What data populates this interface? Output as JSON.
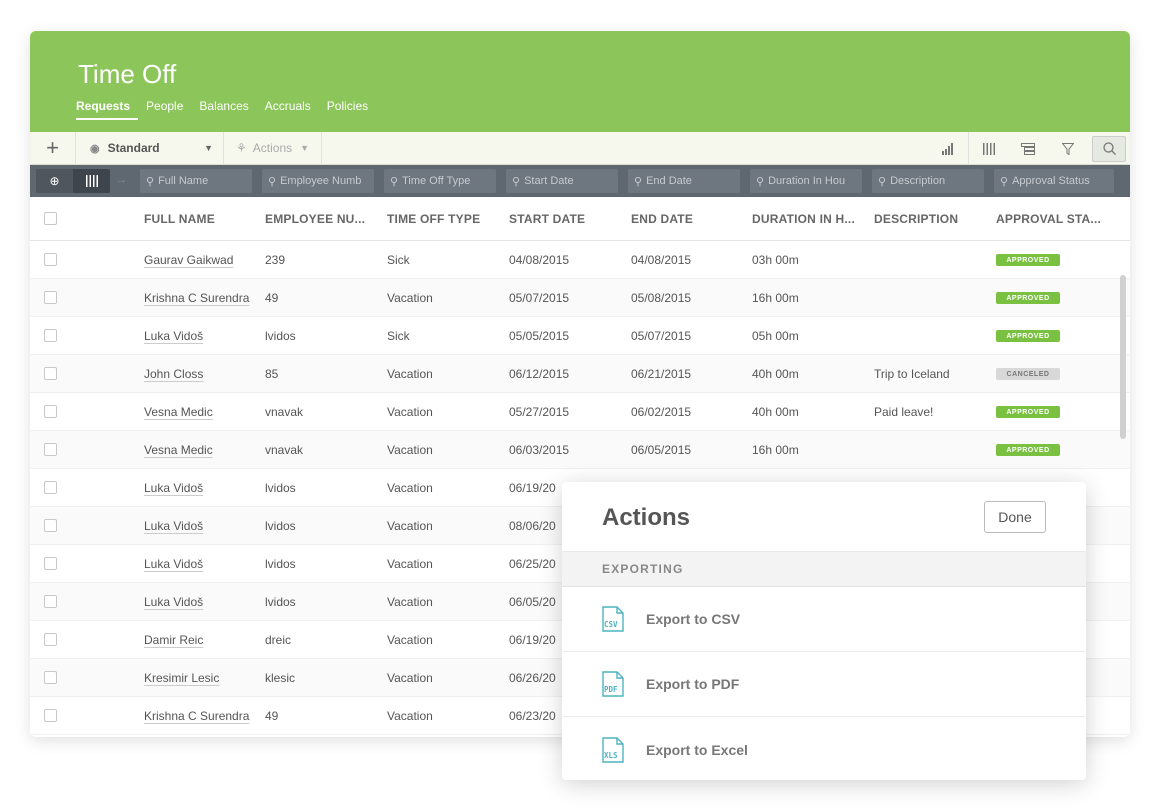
{
  "header": {
    "title": "Time Off",
    "tabs": [
      {
        "label": "Requests",
        "active": true
      },
      {
        "label": "People",
        "active": false
      },
      {
        "label": "Balances",
        "active": false
      },
      {
        "label": "Accruals",
        "active": false
      },
      {
        "label": "Policies",
        "active": false
      }
    ]
  },
  "toolbar": {
    "add_label": "+",
    "view_label": "Standard",
    "actions_label": "Actions"
  },
  "filters": {
    "full_name": "Full Name",
    "employee_number": "Employee Numb",
    "time_off_type": "Time Off Type",
    "start_date": "Start Date",
    "end_date": "End Date",
    "duration": "Duration In Hou",
    "description": "Description",
    "approval_status": "Approval Status"
  },
  "columns": {
    "full_name": "FULL NAME",
    "employee_number": "EMPLOYEE NU...",
    "time_off_type": "TIME OFF TYPE",
    "start_date": "START DATE",
    "end_date": "END DATE",
    "duration": "DURATION IN H...",
    "description": "DESCRIPTION",
    "approval_status": "APPROVAL STA..."
  },
  "rows": [
    {
      "name": "Gaurav Gaikwad",
      "emp": "239",
      "type": "Sick",
      "start": "04/08/2015",
      "end": "04/08/2015",
      "duration": "03h 00m",
      "desc": "",
      "status": "APPROVED"
    },
    {
      "name": "Krishna C Surendra",
      "emp": "49",
      "type": "Vacation",
      "start": "05/07/2015",
      "end": "05/08/2015",
      "duration": "16h 00m",
      "desc": "",
      "status": "APPROVED"
    },
    {
      "name": "Luka Vidoš",
      "emp": "lvidos",
      "type": "Sick",
      "start": "05/05/2015",
      "end": "05/07/2015",
      "duration": "05h 00m",
      "desc": "",
      "status": "APPROVED"
    },
    {
      "name": "John Closs",
      "emp": "85",
      "type": "Vacation",
      "start": "06/12/2015",
      "end": "06/21/2015",
      "duration": "40h 00m",
      "desc": "Trip to Iceland",
      "status": "CANCELED"
    },
    {
      "name": "Vesna Medic",
      "emp": "vnavak",
      "type": "Vacation",
      "start": "05/27/2015",
      "end": "06/02/2015",
      "duration": "40h 00m",
      "desc": "Paid leave!",
      "status": "APPROVED"
    },
    {
      "name": "Vesna Medic",
      "emp": "vnavak",
      "type": "Vacation",
      "start": "06/03/2015",
      "end": "06/05/2015",
      "duration": "16h 00m",
      "desc": "",
      "status": "APPROVED"
    },
    {
      "name": "Luka Vidoš",
      "emp": "lvidos",
      "type": "Vacation",
      "start": "06/19/20",
      "end": "",
      "duration": "",
      "desc": "",
      "status": ""
    },
    {
      "name": "Luka Vidoš",
      "emp": "lvidos",
      "type": "Vacation",
      "start": "08/06/20",
      "end": "",
      "duration": "",
      "desc": "",
      "status": ""
    },
    {
      "name": "Luka Vidoš",
      "emp": "lvidos",
      "type": "Vacation",
      "start": "06/25/20",
      "end": "",
      "duration": "",
      "desc": "",
      "status": ""
    },
    {
      "name": "Luka Vidoš",
      "emp": "lvidos",
      "type": "Vacation",
      "start": "06/05/20",
      "end": "",
      "duration": "",
      "desc": "",
      "status": ""
    },
    {
      "name": "Damir Reic",
      "emp": "dreic",
      "type": "Vacation",
      "start": "06/19/20",
      "end": "",
      "duration": "",
      "desc": "",
      "status": ""
    },
    {
      "name": "Kresimir Lesic",
      "emp": "klesic",
      "type": "Vacation",
      "start": "06/26/20",
      "end": "",
      "duration": "",
      "desc": "",
      "status": ""
    },
    {
      "name": "Krishna C Surendra",
      "emp": "49",
      "type": "Vacation",
      "start": "06/23/20",
      "end": "",
      "duration": "",
      "desc": "",
      "status": ""
    }
  ],
  "actions_panel": {
    "title": "Actions",
    "done_label": "Done",
    "section_label": "EXPORTING",
    "items": [
      {
        "label": "Export to CSV",
        "icon_text": "CSV"
      },
      {
        "label": "Export to PDF",
        "icon_text": "PDF"
      },
      {
        "label": "Export to Excel",
        "icon_text": "XLS"
      }
    ]
  },
  "colors": {
    "header_green": "#8cc65a",
    "approved_green": "#7ac142",
    "filter_bar": "#5f6770",
    "icon_teal": "#4fb3bf"
  }
}
